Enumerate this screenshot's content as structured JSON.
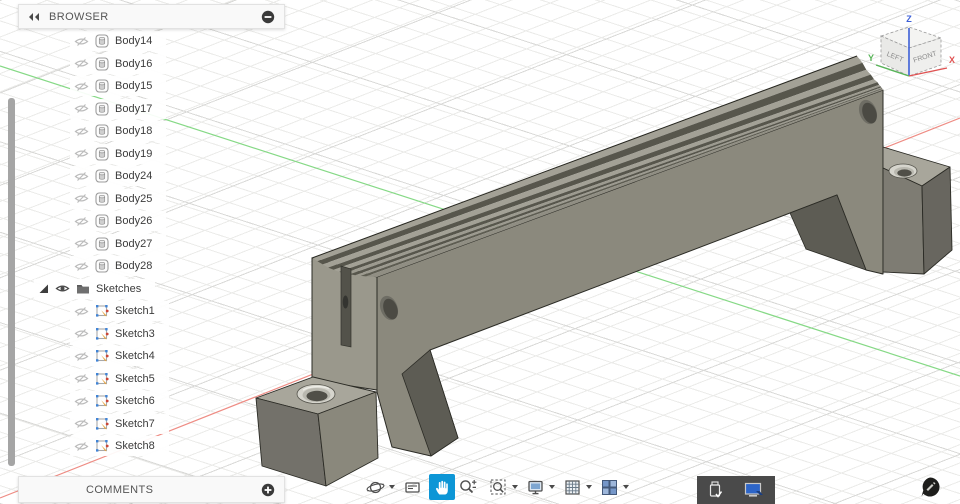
{
  "colors": {
    "accent_blue": "#0d96d6",
    "axis_x_red": "#ee8c84",
    "axis_y_green": "#86d986",
    "cube_x": "#e05252",
    "cube_y": "#58b458",
    "cube_z": "#3c5fd7",
    "model_gray": "#8b897d"
  },
  "browser": {
    "title": "BROWSER",
    "collapse_icon": "double-left-chevron-icon",
    "minimize_icon": "circle-minus-icon",
    "rows": [
      {
        "label": "Body14",
        "type": "body",
        "visible": false
      },
      {
        "label": "Body16",
        "type": "body",
        "visible": false
      },
      {
        "label": "Body15",
        "type": "body",
        "visible": false
      },
      {
        "label": "Body17",
        "type": "body",
        "visible": false
      },
      {
        "label": "Body18",
        "type": "body",
        "visible": false
      },
      {
        "label": "Body19",
        "type": "body",
        "visible": false
      },
      {
        "label": "Body24",
        "type": "body",
        "visible": false
      },
      {
        "label": "Body25",
        "type": "body",
        "visible": false
      },
      {
        "label": "Body26",
        "type": "body",
        "visible": false
      },
      {
        "label": "Body27",
        "type": "body",
        "visible": false
      },
      {
        "label": "Body28",
        "type": "body",
        "visible": false
      },
      {
        "label": "Sketches",
        "type": "folder",
        "visible": true,
        "expanded": true
      },
      {
        "label": "Sketch1",
        "type": "sketch",
        "visible": false
      },
      {
        "label": "Sketch3",
        "type": "sketch",
        "visible": false
      },
      {
        "label": "Sketch4",
        "type": "sketch",
        "visible": false
      },
      {
        "label": "Sketch5",
        "type": "sketch",
        "visible": false
      },
      {
        "label": "Sketch6",
        "type": "sketch",
        "visible": false
      },
      {
        "label": "Sketch7",
        "type": "sketch",
        "visible": false
      },
      {
        "label": "Sketch8",
        "type": "sketch",
        "visible": false
      }
    ]
  },
  "comments": {
    "title": "COMMENTS",
    "add_icon": "circle-plus-icon"
  },
  "navbar": {
    "items": [
      {
        "name": "orbit",
        "icon": "orbit-icon",
        "caret": true,
        "active": false
      },
      {
        "name": "look-at",
        "icon": "look-at-icon",
        "caret": false,
        "active": false
      },
      {
        "name": "pan",
        "icon": "pan-hand-icon",
        "caret": false,
        "active": true
      },
      {
        "name": "zoom",
        "icon": "zoom-magnifier-icon",
        "caret": false,
        "active": false
      },
      {
        "name": "fit",
        "icon": "fit-magnifier-icon",
        "caret": true,
        "active": false
      },
      {
        "name": "display-settings",
        "icon": "display-settings-icon",
        "caret": true,
        "active": false
      },
      {
        "name": "grid-and-snaps",
        "icon": "grid-icon",
        "caret": true,
        "active": false
      },
      {
        "name": "viewports",
        "icon": "viewports-icon",
        "caret": true,
        "active": false
      }
    ]
  },
  "viewcube": {
    "faces": {
      "left": "LEFT",
      "front": "FRONT"
    },
    "axes": {
      "x": {
        "label": "X",
        "color": "#e05252"
      },
      "y": {
        "label": "Y",
        "color": "#58b458"
      },
      "z": {
        "label": "Z",
        "color": "#3c5fd7"
      }
    }
  },
  "tray": {
    "icons": [
      "usb-device-icon",
      "display-device-icon"
    ]
  }
}
